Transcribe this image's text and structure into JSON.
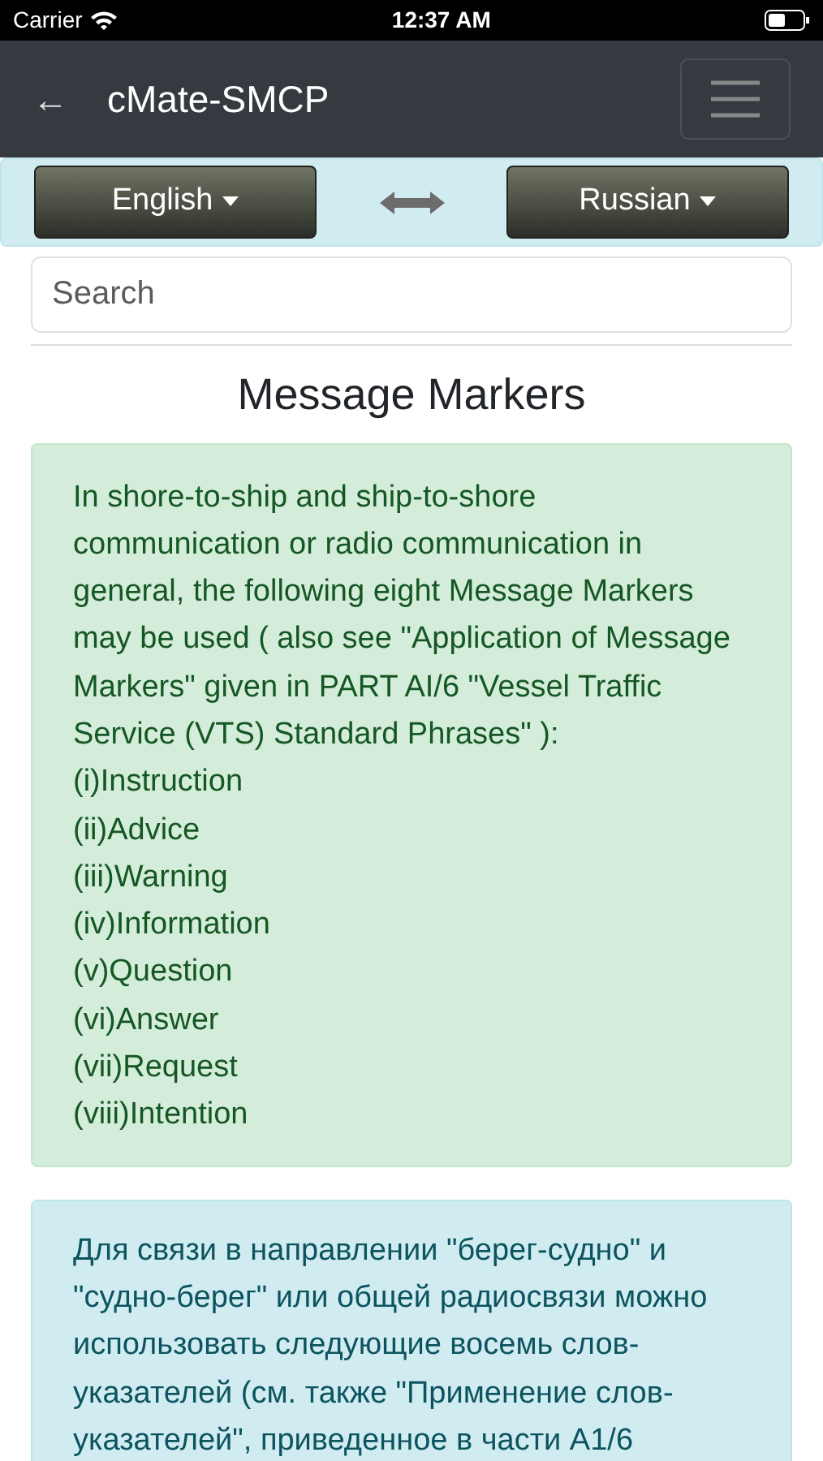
{
  "status_bar": {
    "carrier": "Carrier",
    "time": "12:37 AM"
  },
  "navbar": {
    "back": "←",
    "title": "cMate-SMCP"
  },
  "languages": {
    "source": "English",
    "target": "Russian"
  },
  "search": {
    "placeholder": "Search"
  },
  "heading": "Message Markers",
  "english_card": {
    "intro": "In shore-to-ship and ship-to-shore communication or radio communication in general, the following eight Message Markers may be used ( also see \"Application of Message Markers\" given in PART AI/6 \"Vessel Traffic Service (VTS) Standard Phrases\" ):",
    "items": [
      "(i)Instruction",
      "(ii)Advice",
      "(iii)Warning",
      "(iv)Information",
      "(v)Question",
      "(vi)Answer",
      "(vii)Request",
      "(viii)Intention"
    ]
  },
  "russian_card": {
    "intro": "Для связи в направлении \"берег-судно\" и \"судно-берег\" или общей радиосвязи можно использовать следующие восемь слов-указателей (см. также \"Применение слов-указателей\", приведенное в части А1/6"
  }
}
